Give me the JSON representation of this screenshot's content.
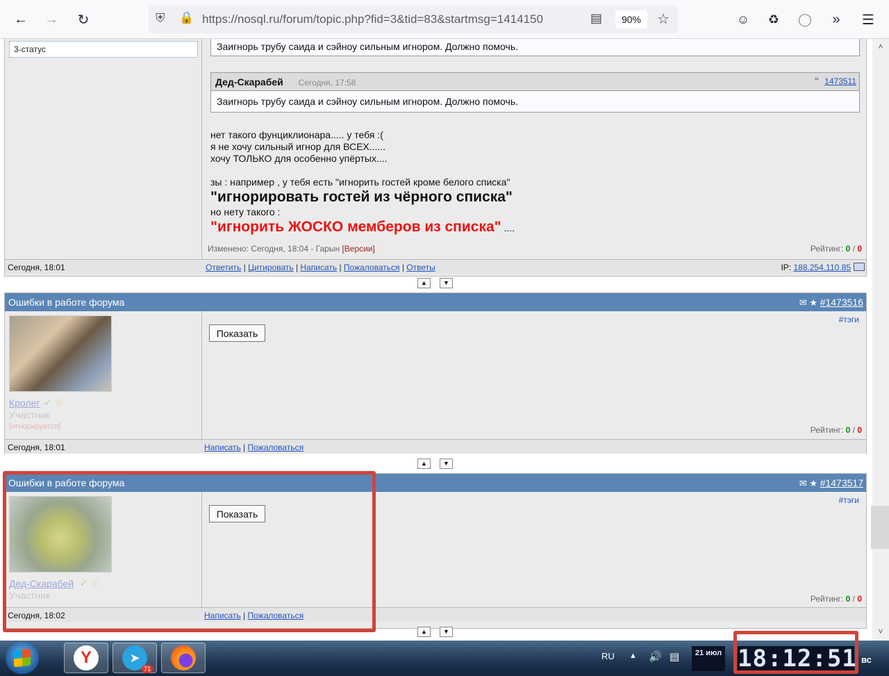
{
  "browser": {
    "url": "https://nosql.ru/forum/topic.php?fid=3&tid=83&startmsg=1414150",
    "zoom": "90%"
  },
  "post1": {
    "status": "3-статус",
    "quote_top_body": "Заигнорь трубу саида и сэйноу сильным игнором. Должно помочь.",
    "quote": {
      "author": "Дед-Скарабей",
      "time": "Сегодня, 17:58",
      "link": "1473511",
      "body": "Заигнорь трубу саида и сэйноу сильным игнором. Должно помочь."
    },
    "lines": [
      "нет такого фунциклионара..... у тебя :(",
      "я не хочу сильный игнор для ВСЕХ......",
      "хочу ТОЛЬКО для особенно упёртых....",
      "зы : например , у тебя есть \"игнорить гостей кроме белого списка\"",
      "\"игнорировать гостей из чёрного списка\"",
      "но нету такого :",
      "\"игнорить ЖОСКО мемберов из списка\"",
      " ...."
    ],
    "edited": "Изменено: Сегодня, 18:04 - Гарын",
    "versions": "[Версии]",
    "rating_label": "Рейтинг:",
    "rating_plus": "0",
    "rating_minus": "0",
    "footer_date": "Сегодня, 18:01",
    "footer_links": [
      "Ответить",
      "Цитировать",
      "Написать",
      "Пожаловаться",
      "Ответы"
    ],
    "ip_label": "IP:",
    "ip": "188.254.110.85"
  },
  "post2": {
    "title": "Ошибки в работе форума",
    "number": "#1473516",
    "tags": "#тэги",
    "show": "Показать",
    "username": "Кролег",
    "role": "Участник",
    "ignored": "[игнорируется]",
    "rating_label": "Рейтинг:",
    "rating_plus": "0",
    "rating_minus": "0",
    "footer_date": "Сегодня, 18:01",
    "footer_links": [
      "Написать",
      "Пожаловаться"
    ]
  },
  "post3": {
    "title": "Ошибки в работе форума",
    "number": "#1473517",
    "tags": "#тэги",
    "show": "Показать",
    "username": "Дед-Скарабей",
    "role": "Участник",
    "rating_label": "Рейтинг:",
    "rating_plus": "0",
    "rating_minus": "0",
    "footer_date": "Сегодня, 18:02",
    "footer_links": [
      "Написать",
      "Пожаловаться"
    ]
  },
  "taskbar": {
    "lang": "RU",
    "telegram_badge": "71",
    "clock": "18:12:51",
    "date_small": "21 июл",
    "day": "вс"
  }
}
